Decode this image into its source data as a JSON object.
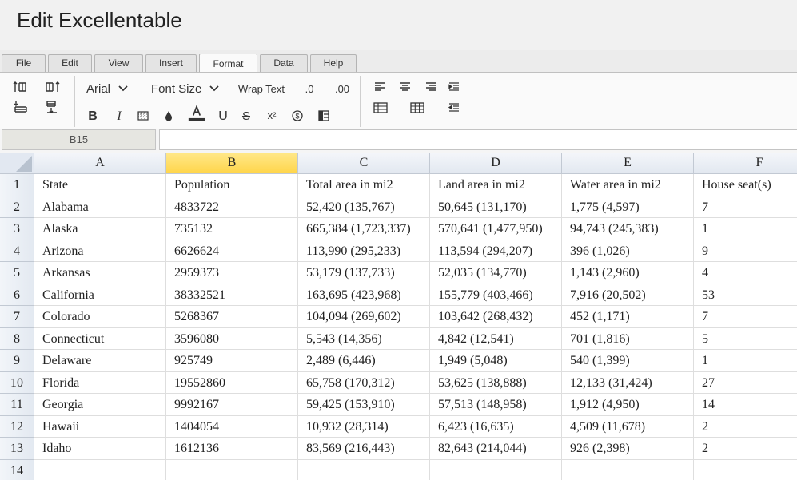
{
  "app": {
    "title": "Edit Excellentable"
  },
  "menu_tabs": [
    {
      "label": "File"
    },
    {
      "label": "Edit"
    },
    {
      "label": "View"
    },
    {
      "label": "Insert"
    },
    {
      "label": "Format",
      "active": true
    },
    {
      "label": "Data"
    },
    {
      "label": "Help"
    }
  ],
  "toolbar": {
    "font_family": "Arial",
    "font_size_label": "Font Size",
    "wrap_text_label": "Wrap Text",
    "decrease_decimal_label": ".0",
    "increase_decimal_label": ".00",
    "bold_label": "B",
    "italic_label": "I",
    "underline_label": "U",
    "strikethrough_label": "S",
    "superscript_label": "x²"
  },
  "formula_bar": {
    "cell_ref": "B15",
    "value": ""
  },
  "grid": {
    "selected_column": "B",
    "columns": [
      "A",
      "B",
      "C",
      "D",
      "E",
      "F"
    ],
    "row_numbers": [
      "1",
      "2",
      "3",
      "4",
      "5",
      "6",
      "7",
      "8",
      "9",
      "10",
      "11",
      "12",
      "13",
      "14"
    ],
    "rows": [
      [
        "State",
        "Population",
        "Total area in mi2",
        "Land area in mi2",
        "Water area in mi2",
        "House seat(s)"
      ],
      [
        "Alabama",
        "4833722",
        "52,420 (135,767)",
        "50,645 (131,170)",
        "1,775 (4,597)",
        "7"
      ],
      [
        "Alaska",
        "735132",
        "665,384 (1,723,337)",
        "570,641 (1,477,950)",
        "94,743 (245,383)",
        "1"
      ],
      [
        "Arizona",
        "6626624",
        "113,990 (295,233)",
        "113,594 (294,207)",
        "396 (1,026)",
        "9"
      ],
      [
        "Arkansas",
        "2959373",
        "53,179 (137,733)",
        "52,035 (134,770)",
        "1,143 (2,960)",
        "4"
      ],
      [
        "California",
        "38332521",
        "163,695 (423,968)",
        "155,779 (403,466)",
        "7,916 (20,502)",
        "53"
      ],
      [
        "Colorado",
        "5268367",
        "104,094 (269,602)",
        "103,642 (268,432)",
        "452 (1,171)",
        "7"
      ],
      [
        "Connecticut",
        "3596080",
        "5,543 (14,356)",
        "4,842 (12,541)",
        "701 (1,816)",
        "5"
      ],
      [
        "Delaware",
        "925749",
        "2,489 (6,446)",
        "1,949 (5,048)",
        "540 (1,399)",
        "1"
      ],
      [
        "Florida",
        "19552860",
        "65,758 (170,312)",
        "53,625 (138,888)",
        "12,133 (31,424)",
        "27"
      ],
      [
        "Georgia",
        "9992167",
        "59,425 (153,910)",
        "57,513 (148,958)",
        "1,912 (4,950)",
        "14"
      ],
      [
        "Hawaii",
        "1404054",
        "10,932 (28,314)",
        "6,423 (16,635)",
        "4,509 (11,678)",
        "2"
      ],
      [
        "Idaho",
        "1612136",
        "83,569 (216,443)",
        "82,643 (214,044)",
        "926 (2,398)",
        "2"
      ],
      [
        "",
        "",
        "",
        "",
        "",
        ""
      ]
    ]
  }
}
